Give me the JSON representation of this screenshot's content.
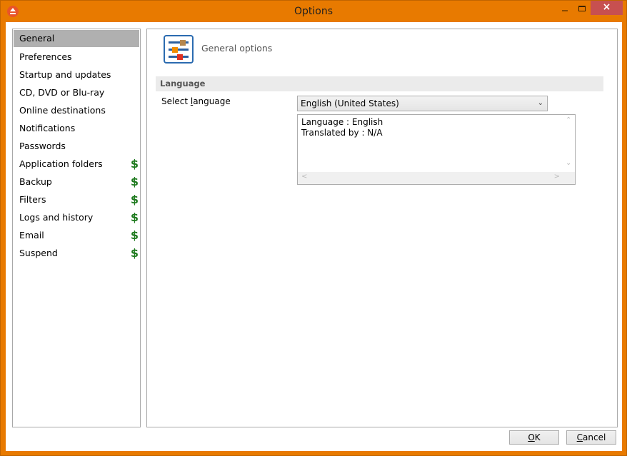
{
  "window": {
    "title": "Options",
    "controls": {
      "minimize": "minimize",
      "maximize": "maximize",
      "close": "×"
    }
  },
  "sidebar": {
    "items": [
      {
        "label": "General",
        "selected": true,
        "premium": false
      },
      {
        "label": "Preferences",
        "selected": false,
        "premium": false
      },
      {
        "label": "Startup and updates",
        "selected": false,
        "premium": false
      },
      {
        "label": "CD, DVD or Blu-ray",
        "selected": false,
        "premium": false
      },
      {
        "label": "Online destinations",
        "selected": false,
        "premium": false
      },
      {
        "label": "Notifications",
        "selected": false,
        "premium": false
      },
      {
        "label": "Passwords",
        "selected": false,
        "premium": false
      },
      {
        "label": "Application folders",
        "selected": false,
        "premium": true
      },
      {
        "label": "Backup",
        "selected": false,
        "premium": true
      },
      {
        "label": "Filters",
        "selected": false,
        "premium": true
      },
      {
        "label": "Logs and history",
        "selected": false,
        "premium": true
      },
      {
        "label": "Email",
        "selected": false,
        "premium": true
      },
      {
        "label": "Suspend",
        "selected": false,
        "premium": true
      }
    ],
    "premium_symbol": "$",
    "premium_color": "#1e7a1e"
  },
  "content": {
    "header_title": "General options",
    "header_icon": "sliders-icon",
    "section_title": "Language",
    "select_label_pre": "Select ",
    "select_label_access": "l",
    "select_label_post": "anguage",
    "language_value": "English (United States)",
    "info_lines": [
      "Language : English",
      "Translated by : N/A"
    ]
  },
  "footer": {
    "ok_access": "O",
    "ok_rest": "K",
    "cancel_access": "C",
    "cancel_rest": "ancel"
  },
  "colors": {
    "frame": "#e87a00",
    "close_button": "#c75050",
    "selected_item": "#b0b0b0",
    "icon_border": "#2b6bb0"
  }
}
